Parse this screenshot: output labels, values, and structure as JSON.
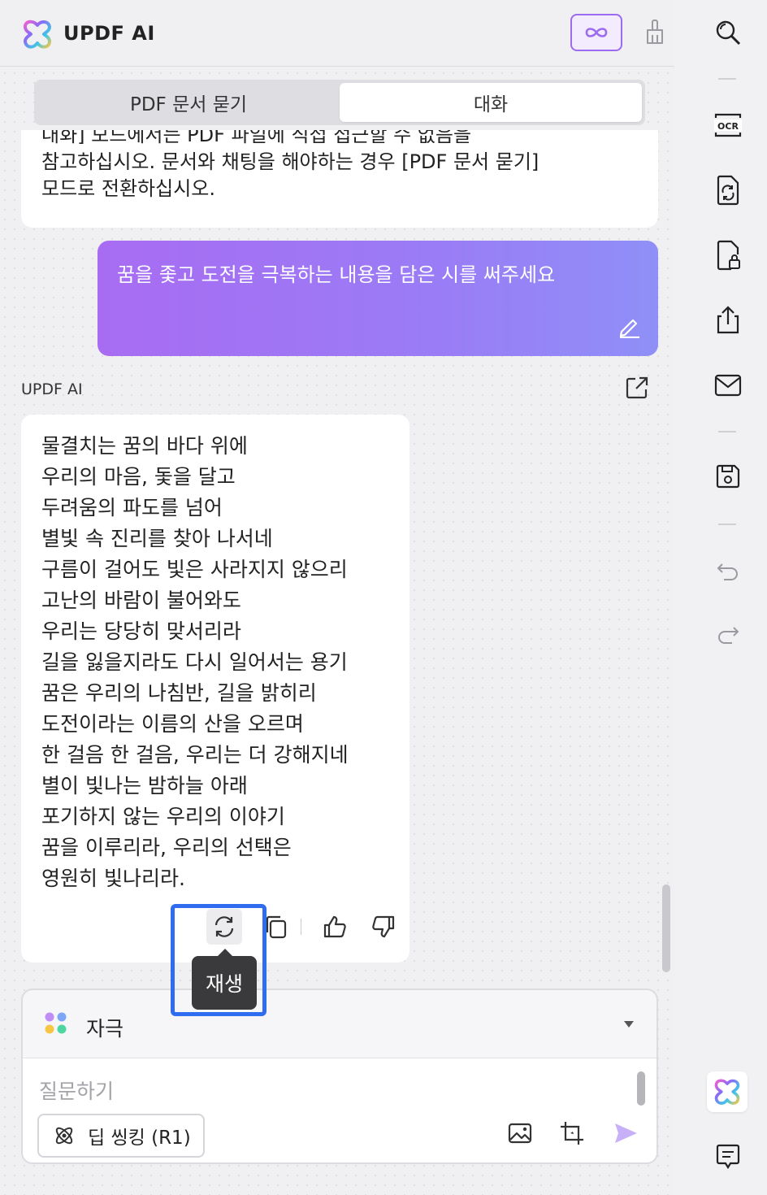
{
  "header": {
    "title": "UPDF AI",
    "infinity_icon": "infinity-icon",
    "clear_icon": "broom-icon",
    "accent": "#9b6cf0"
  },
  "tabs": [
    {
      "label": "PDF 문서 묻기",
      "active": false
    },
    {
      "label": "대화",
      "active": true
    }
  ],
  "chat": {
    "system_lines": [
      "대화] 모드에서는 PDF 파일에 직접 접근할 수 없음을",
      "참고하십시오. 문서와 채팅을 해야하는 경우 [PDF 문서 묻기]",
      "모드로 전환하십시오."
    ],
    "user_message": "꿈을 좇고 도전을 극복하는 내용을 담은 시를 써주세요",
    "ai_label": "UPDF AI",
    "poem": [
      "물결치는 꿈의 바다 위에",
      "우리의 마음, 돛을 달고",
      "두려움의 파도를 넘어",
      "별빛 속 진리를 찾아 나서네",
      "구름이 걸어도 빛은 사라지지 않으리",
      "고난의 바람이 불어와도",
      "우리는 당당히 맞서리라",
      "길을 잃을지라도 다시 일어서는 용기",
      "꿈은 우리의 나침반, 길을 밝히리",
      "도전이라는 이름의 산을 오르며",
      "한 걸음 한 걸음, 우리는 더 강해지네",
      "별이 빛나는 밤하늘 아래",
      "포기하지 않는 우리의 이야기",
      "꿈을 이루리라, 우리의 선택은",
      "영원히 빛나리라."
    ],
    "tooltip": "재생",
    "user_bubble_gradient": [
      "#a86cf2",
      "#8f8ff7"
    ],
    "highlight_color": "#2f6cf0"
  },
  "input": {
    "prompt_label": "자극",
    "placeholder": "질문하기",
    "deep_thinking_label": "딥 씽킹 (R1)"
  },
  "sidebar": {
    "items": [
      "search-icon",
      "ocr-icon",
      "convert-icon",
      "protect-icon",
      "share-icon",
      "mail-icon",
      "save-icon",
      "undo-icon",
      "redo-icon",
      "updf-ai-icon",
      "comment-icon"
    ]
  }
}
